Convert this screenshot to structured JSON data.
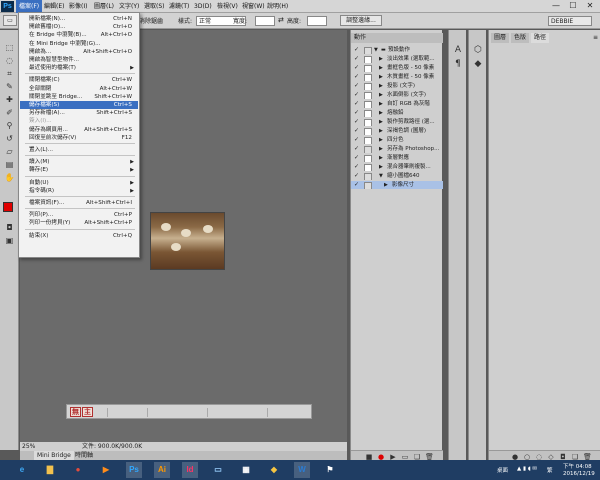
{
  "app": {
    "logo": "Ps"
  },
  "menubar": {
    "items": [
      "檔案(F)",
      "編輯(E)",
      "影像(I)",
      "圖層(L)",
      "文字(Y)",
      "選取(S)",
      "濾鏡(T)",
      "3D(D)",
      "檢視(V)",
      "視窗(W)",
      "說明(H)"
    ],
    "active_index": 0
  },
  "window_controls": {
    "minimize": "—",
    "maximize": "☐",
    "close": "✕"
  },
  "options_bar": {
    "antialias_label": "消除鋸齒",
    "style_label": "樣式:",
    "style_value": "正常",
    "width_label": "寬度:",
    "height_label": "高度:",
    "refine_button": "調整邊緣...",
    "workspace_value": "DEBBIE"
  },
  "file_menu": {
    "items": [
      {
        "label": "開新檔案(N)...",
        "shortcut": "Ctrl+N"
      },
      {
        "label": "開啟舊檔(O)...",
        "shortcut": "Ctrl+O"
      },
      {
        "label": "在 Bridge 中瀏覽(B)...",
        "shortcut": "Alt+Ctrl+O"
      },
      {
        "label": "在 Mini Bridge 中瀏覽(G)...",
        "shortcut": ""
      },
      {
        "label": "開啟為...",
        "shortcut": "Alt+Shift+Ctrl+O"
      },
      {
        "label": "開啟為智慧型物件...",
        "shortcut": ""
      },
      {
        "label": "最近使用的檔案(T)",
        "shortcut": "",
        "submenu": true
      },
      {
        "sep": true
      },
      {
        "label": "關閉檔案(C)",
        "shortcut": "Ctrl+W"
      },
      {
        "label": "全部關閉",
        "shortcut": "Alt+Ctrl+W"
      },
      {
        "label": "關閉並跳至 Bridge...",
        "shortcut": "Shift+Ctrl+W"
      },
      {
        "label": "儲存檔案(S)",
        "shortcut": "Ctrl+S",
        "highlight": true
      },
      {
        "label": "另存新檔(A)...",
        "shortcut": "Shift+Ctrl+S"
      },
      {
        "label": "簽入(I)...",
        "shortcut": "",
        "disabled": true
      },
      {
        "label": "儲存為網頁用...",
        "shortcut": "Alt+Shift+Ctrl+S"
      },
      {
        "label": "回復至前次儲存(V)",
        "shortcut": "F12"
      },
      {
        "sep": true
      },
      {
        "label": "置入(L)...",
        "shortcut": ""
      },
      {
        "sep": true
      },
      {
        "label": "讀入(M)",
        "shortcut": "",
        "submenu": true
      },
      {
        "label": "轉存(E)",
        "shortcut": "",
        "submenu": true
      },
      {
        "sep": true
      },
      {
        "label": "自動(U)",
        "shortcut": "",
        "submenu": true
      },
      {
        "label": "指令碼(R)",
        "shortcut": "",
        "submenu": true
      },
      {
        "sep": true
      },
      {
        "label": "檔案資訊(F)...",
        "shortcut": "Alt+Shift+Ctrl+I"
      },
      {
        "sep": true
      },
      {
        "label": "列印(P)...",
        "shortcut": "Ctrl+P"
      },
      {
        "label": "列印一份拷貝(Y)",
        "shortcut": "Alt+Shift+Ctrl+P"
      },
      {
        "sep": true
      },
      {
        "label": "結束(X)",
        "shortcut": "Ctrl+Q"
      }
    ]
  },
  "film_bar": {
    "stamp1": "無",
    "stamp2": "主"
  },
  "status_bar": {
    "zoom": "25%",
    "doc_info": "文件: 900.0K/900.0K"
  },
  "bottom_tabs": [
    "Mini Bridge",
    "時間軸"
  ],
  "actions_panel": {
    "tab": "動作",
    "rows": [
      {
        "label": "預設動作",
        "check": true,
        "dialog": false,
        "open": true,
        "indent": 0,
        "folder": true
      },
      {
        "label": "淡出效果 (選取範...",
        "check": true,
        "dialog": true,
        "open": false,
        "indent": 1
      },
      {
        "label": "畫框色版 - 50 像素",
        "check": true,
        "dialog": true,
        "open": false,
        "indent": 1
      },
      {
        "label": "木質畫框 - 50 像素",
        "check": true,
        "dialog": true,
        "open": false,
        "indent": 1
      },
      {
        "label": "投影 (文字)",
        "check": true,
        "dialog": true,
        "open": false,
        "indent": 1
      },
      {
        "label": "水面倒影 (文字)",
        "check": true,
        "dialog": true,
        "open": false,
        "indent": 1
      },
      {
        "label": "自訂 RGB 為灰階",
        "check": true,
        "dialog": true,
        "open": false,
        "indent": 1
      },
      {
        "label": "熔融鉛",
        "check": true,
        "dialog": true,
        "open": false,
        "indent": 1
      },
      {
        "label": "製作剪裁路徑 (選...",
        "check": true,
        "dialog": true,
        "open": false,
        "indent": 1
      },
      {
        "label": "深褐色調 (圖層)",
        "check": true,
        "dialog": true,
        "open": false,
        "indent": 1
      },
      {
        "label": "四分色",
        "check": true,
        "dialog": true,
        "open": false,
        "indent": 1
      },
      {
        "label": "另存為 Photoshop...",
        "check": true,
        "dialog": false,
        "open": false,
        "indent": 1
      },
      {
        "label": "漸層對應",
        "check": true,
        "dialog": true,
        "open": false,
        "indent": 1
      },
      {
        "label": "混合器筆刷複製...",
        "check": true,
        "dialog": true,
        "open": false,
        "indent": 1
      },
      {
        "label": "縮小圖檔640",
        "check": true,
        "dialog": false,
        "open": true,
        "indent": 1
      },
      {
        "label": "影像尺寸",
        "check": true,
        "dialog": false,
        "open": false,
        "indent": 2,
        "selected": true
      }
    ]
  },
  "layers_panel": {
    "tabs": [
      "圖層",
      "色版",
      "路徑"
    ],
    "active_index": 2
  },
  "taskbar": {
    "apps": [
      {
        "name": "ie-icon",
        "glyph": "e",
        "color": "#3fa9f5"
      },
      {
        "name": "explorer-icon",
        "glyph": "▇",
        "color": "#f2c14e"
      },
      {
        "name": "chrome-icon",
        "glyph": "●",
        "color": "#e44c3c"
      },
      {
        "name": "media-icon",
        "glyph": "▶",
        "color": "#ff8c1a"
      },
      {
        "name": "photoshop-icon",
        "glyph": "Ps",
        "color": "#31a8ff"
      },
      {
        "name": "illustrator-icon",
        "glyph": "Ai",
        "color": "#ff9a00"
      },
      {
        "name": "indesign-icon",
        "glyph": "Id",
        "color": "#ff3366"
      },
      {
        "name": "screen-icon",
        "glyph": "▭",
        "color": "#9ad0ff"
      },
      {
        "name": "windows-icon",
        "glyph": "▦",
        "color": "#ffffff"
      },
      {
        "name": "paint-icon",
        "glyph": "◆",
        "color": "#f5c542"
      },
      {
        "name": "word-icon",
        "glyph": "W",
        "color": "#2b7cd3"
      },
      {
        "name": "flag-icon",
        "glyph": "⚑",
        "color": "#ffffff"
      }
    ],
    "desktop_label": "桌面",
    "ime_label": "繁",
    "time": "下午 04:08",
    "date": "2016/12/19"
  }
}
